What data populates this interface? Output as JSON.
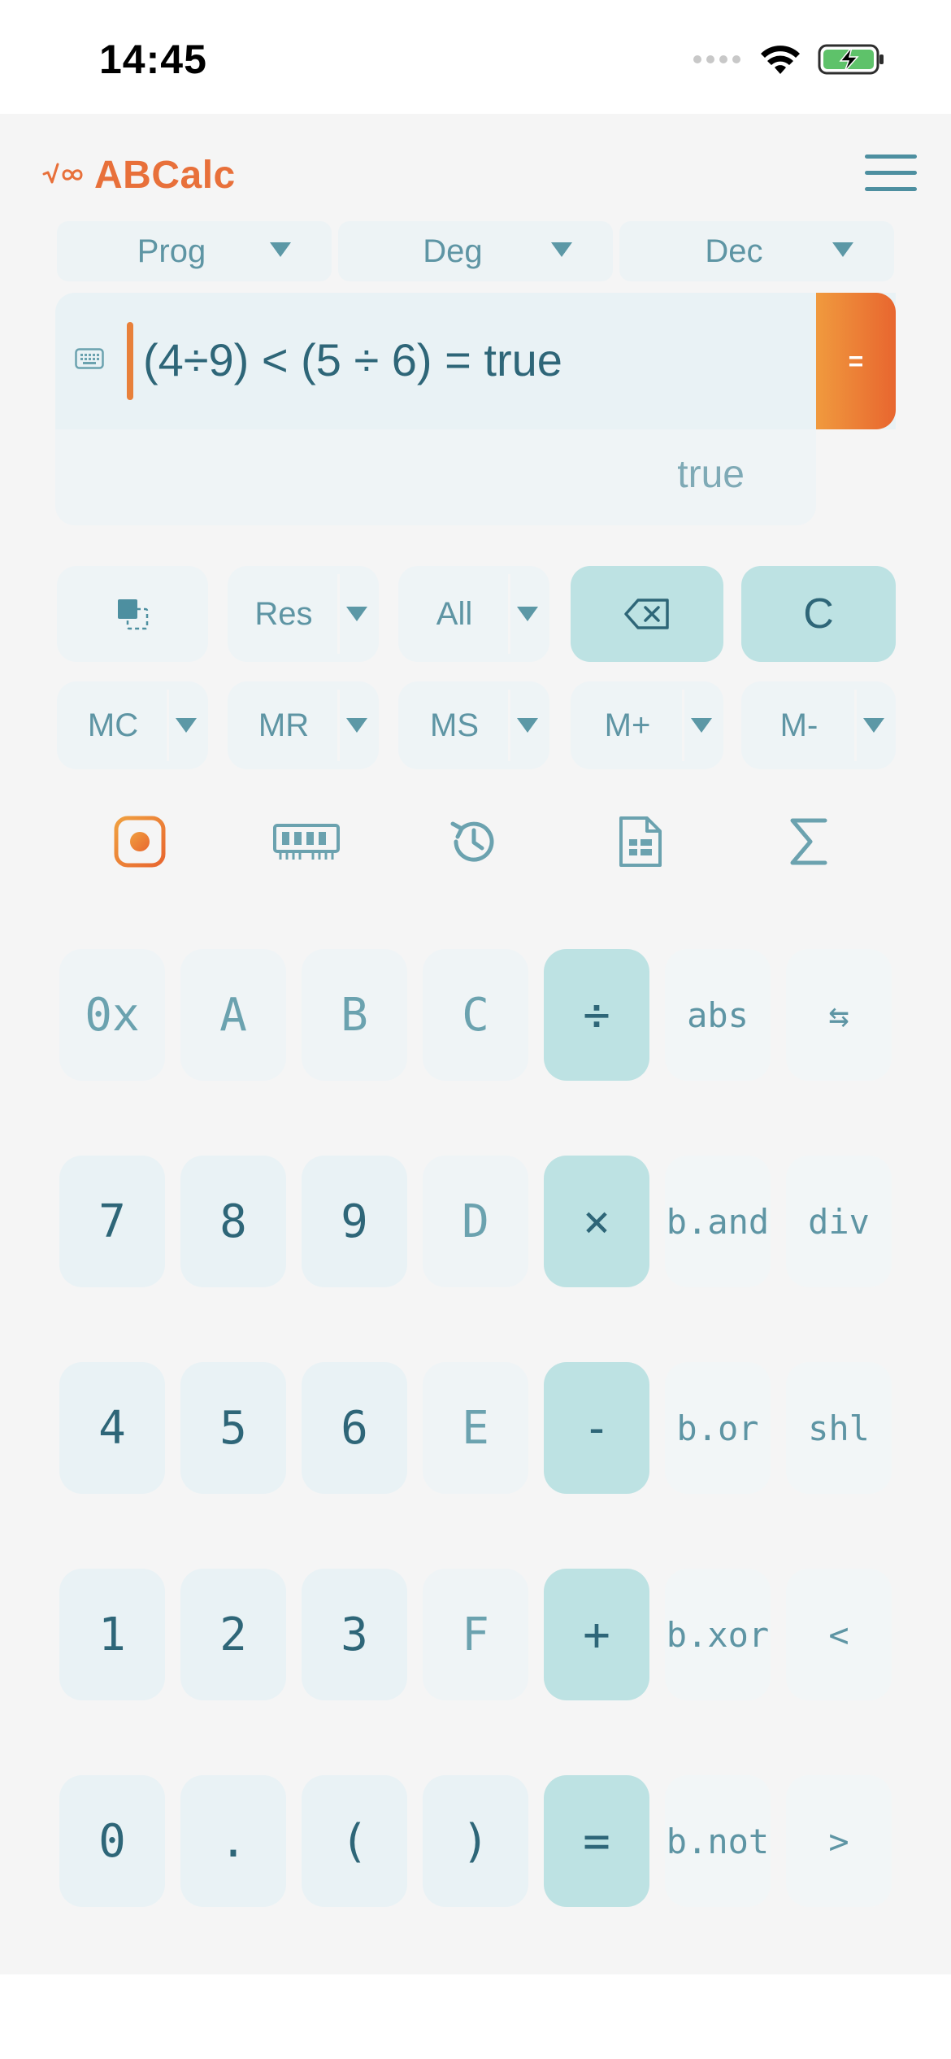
{
  "status_bar": {
    "time": "14:45",
    "icons": [
      "signal-icon",
      "wifi-icon",
      "battery-charging-icon"
    ]
  },
  "header": {
    "app_title": "ABCalc",
    "logo_icon": "sqrt-infinity-logo",
    "menu_icon": "hamburger-menu-icon"
  },
  "modes": {
    "program": "Prog",
    "angle": "Deg",
    "base": "Dec"
  },
  "display": {
    "expression": "(4÷9) < (5 ÷ 6) = true",
    "equals_label": "=",
    "result": "true"
  },
  "controls": {
    "row1": {
      "copy_icon": "copy-selection-icon",
      "res_label": "Res",
      "all_label": "All",
      "backspace_icon": "backspace-icon",
      "clear_label": "C"
    },
    "memory": {
      "mc": "MC",
      "mr": "MR",
      "ms": "MS",
      "mplus": "M+",
      "mminus": "M-"
    }
  },
  "toolbar_icons": [
    "record-icon",
    "memory-chip-icon",
    "history-icon",
    "spreadsheet-icon",
    "sigma-icon"
  ],
  "keypad": {
    "row1": [
      "0x",
      "A",
      "B",
      "C",
      "÷",
      "abs",
      "⇆"
    ],
    "row2": [
      "7",
      "8",
      "9",
      "D",
      "×",
      "b.and",
      "div"
    ],
    "row3": [
      "4",
      "5",
      "6",
      "E",
      "-",
      "b.or",
      "shl"
    ],
    "row4": [
      "1",
      "2",
      "3",
      "F",
      "+",
      "b.xor",
      "<"
    ],
    "row5": [
      "0",
      ".",
      "(",
      ")",
      "=",
      "b.not",
      ">"
    ]
  },
  "colors": {
    "accent_orange": "#e8703a",
    "teal_key": "#bde2e3",
    "light_key": "#e9f2f5",
    "text_dark": "#2e6678",
    "text_mid": "#5e95a4"
  }
}
